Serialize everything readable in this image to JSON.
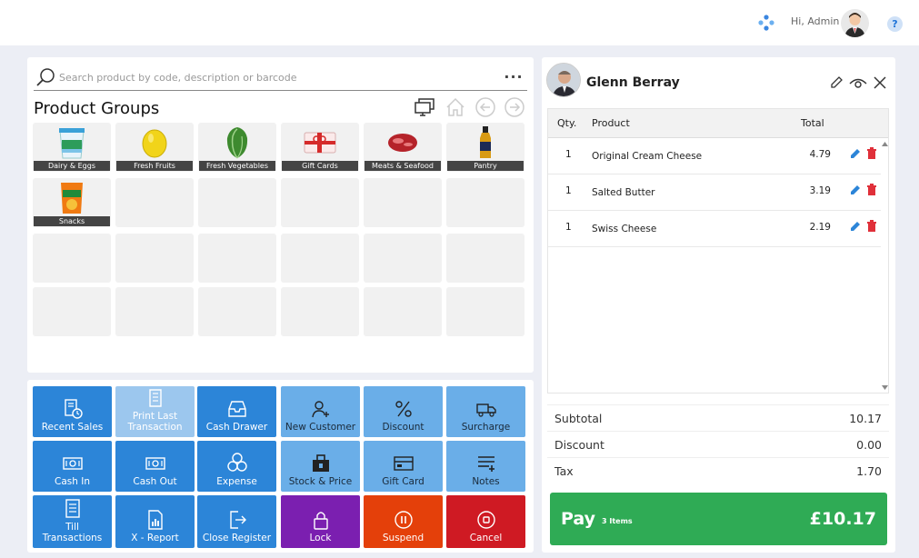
{
  "header": {
    "greeting": "Hi, Admin",
    "help_symbol": "?"
  },
  "search": {
    "placeholder": "Search product by code, description or barcode",
    "more": "..."
  },
  "product_groups": {
    "title": "Product Groups",
    "items": [
      {
        "label": "Dairy & Eggs",
        "icon": "yogurt-tub-icon"
      },
      {
        "label": "Fresh Fruits",
        "icon": "lemon-icon"
      },
      {
        "label": "Fresh Vegetables",
        "icon": "lettuce-icon"
      },
      {
        "label": "Gift Cards",
        "icon": "gift-card-icon"
      },
      {
        "label": "Meats & Seafood",
        "icon": "meat-icon"
      },
      {
        "label": "Pantry",
        "icon": "sauce-bottle-icon"
      },
      {
        "label": "Snacks",
        "icon": "chips-bag-icon"
      }
    ]
  },
  "actions": [
    {
      "label": "Recent Sales",
      "icon": "receipt-clock-icon",
      "style": "blue"
    },
    {
      "label": "Print Last Transaction",
      "icon": "receipt-print-icon",
      "style": "faded"
    },
    {
      "label": "Cash Drawer",
      "icon": "drawer-icon",
      "style": "blue"
    },
    {
      "label": "New Customer",
      "icon": "add-user-icon",
      "style": "lblue"
    },
    {
      "label": "Discount",
      "icon": "percent-icon",
      "style": "lblue"
    },
    {
      "label": "Surcharge",
      "icon": "truck-icon",
      "style": "lblue"
    },
    {
      "label": "Cash In",
      "icon": "cash-in-icon",
      "style": "blue"
    },
    {
      "label": "Cash Out",
      "icon": "cash-out-icon",
      "style": "blue"
    },
    {
      "label": "Expense",
      "icon": "coins-icon",
      "style": "blue"
    },
    {
      "label": "Stock & Price",
      "icon": "box-icon",
      "style": "lblue"
    },
    {
      "label": "Gift Card",
      "icon": "card-icon",
      "style": "lblue"
    },
    {
      "label": "Notes",
      "icon": "notes-icon",
      "style": "lblue"
    },
    {
      "label": "Till Transactions",
      "icon": "document-icon",
      "style": "blue"
    },
    {
      "label": "X - Report",
      "icon": "report-icon",
      "style": "blue"
    },
    {
      "label": "Close Register",
      "icon": "exit-icon",
      "style": "blue"
    },
    {
      "label": "Lock",
      "icon": "lock-icon",
      "style": "purple"
    },
    {
      "label": "Suspend",
      "icon": "pause-icon",
      "style": "orange"
    },
    {
      "label": "Cancel",
      "icon": "stop-icon",
      "style": "red"
    }
  ],
  "customer": {
    "name": "Glenn Berray"
  },
  "cart": {
    "headers": {
      "qty": "Qty.",
      "product": "Product",
      "total": "Total"
    },
    "items": [
      {
        "qty": "1",
        "product": "Original Cream Cheese",
        "total": "4.79"
      },
      {
        "qty": "1",
        "product": "Salted Butter",
        "total": "3.19"
      },
      {
        "qty": "1",
        "product": "Swiss Cheese",
        "total": "2.19"
      }
    ]
  },
  "summary": {
    "subtotal_label": "Subtotal",
    "subtotal": "10.17",
    "discount_label": "Discount",
    "discount": "0.00",
    "tax_label": "Tax",
    "tax": "1.70"
  },
  "pay": {
    "label": "Pay",
    "items": "3 Items",
    "amount": "£10.17"
  },
  "colors": {
    "blue": "#2c85d8",
    "light_blue": "#6aaee8",
    "purple": "#7b1fb0",
    "orange": "#e4400a",
    "red": "#cf1a23",
    "pay_green": "#2fab55"
  }
}
